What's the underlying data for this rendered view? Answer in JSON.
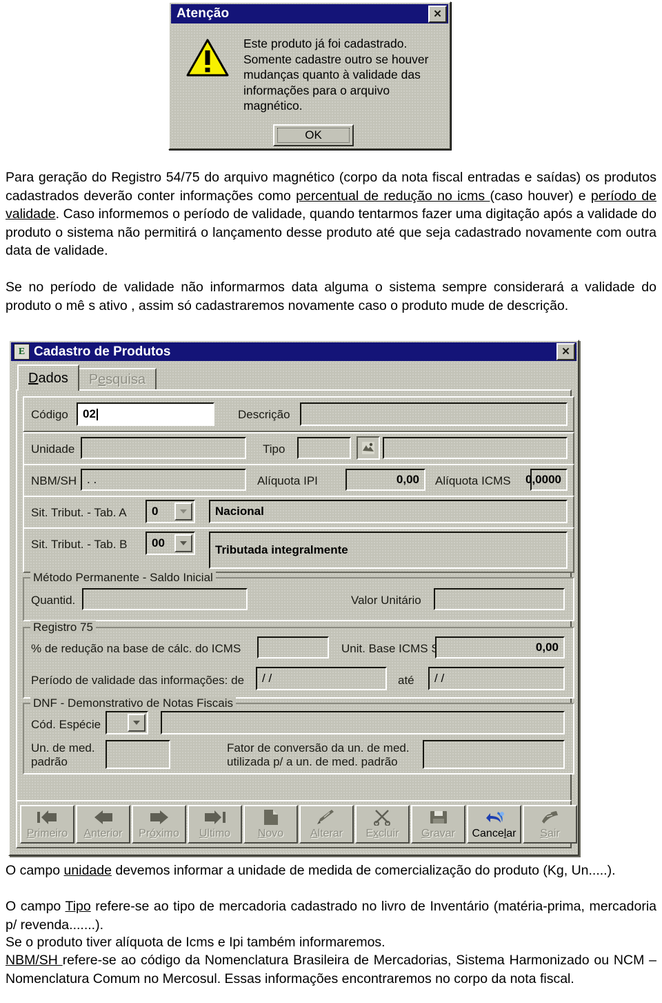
{
  "alert": {
    "title": "Atenção",
    "close_label": "✕",
    "icon": "warning-triangle-icon",
    "message_lines": [
      "Este produto já foi cadastrado.",
      "Somente cadastre outro se houver",
      "mudanças quanto à validade das",
      "informações para o arquivo magnético."
    ],
    "ok_label": "OK"
  },
  "paragraph_top": {
    "html": "Para geração do Registro 54/75 do arquivo magnético (corpo da nota fiscal entradas e saídas) os produtos cadastrados deverão conter informações como <u>percentual de redução no icms </u>(caso houver) e <u> período de validade</u>. Caso informemos o período de validade, quando  tentarmos fazer uma digitação após a validade do produto o sistema não permitirá o lançamento desse produto até que seja cadastrado novamente com outra data de validade."
  },
  "paragraph_top2": {
    "html": "Se no período de validade não informarmos data alguma o sistema sempre considerará a validade do produto o mê s ativo , assim só cadastraremos novamente caso o produto mude de descrição."
  },
  "form": {
    "title": "Cadastro de Produtos",
    "icon": "application-icon",
    "close_label": "✕",
    "tabs": [
      {
        "label": "Dados",
        "accel": "D",
        "active": true
      },
      {
        "label": "Pesquisa",
        "accel": "e",
        "active": false
      }
    ],
    "row_codigo": {
      "codigo_label": "Código",
      "codigo_value": "02",
      "descricao_label": "Descrição",
      "descricao_value": ""
    },
    "row_unidade": {
      "unidade_label": "Unidade",
      "unidade_value": "",
      "tipo_label": "Tipo",
      "tipo_value": "",
      "tipo_icon": "picture-lookup-icon",
      "tipo_desc_value": ""
    },
    "row_nbm": {
      "nbm_label": "NBM/SH",
      "nbm_value": ". .",
      "ipi_label": "Alíquota IPI",
      "ipi_value": "0,00",
      "icms_label": "Alíquota ICMS",
      "icms_value": "0,0000"
    },
    "row_tab_a": {
      "label": "Sit. Tribut. - Tab. A",
      "code": "0",
      "description": "Nacional"
    },
    "row_tab_b": {
      "label": "Sit. Tribut. - Tab. B",
      "code": "00",
      "description": "Tributada integralmente"
    },
    "group_metodo": {
      "title": "Método Permanente - Saldo Inicial",
      "quantid_label": "Quantid.",
      "quantid_value": "",
      "valor_label": "Valor Unitário",
      "valor_value": ""
    },
    "group_registro75": {
      "title": "Registro 75",
      "reducao_label": "% de redução na base de cálc. do ICMS",
      "reducao_value": "",
      "unit_base_label": "Unit. Base ICMS ST",
      "unit_base_value": "0,00",
      "periodo_label": "Período de validade das informações: de",
      "periodo_de_value": "/ /",
      "ate_label": "até",
      "periodo_ate_value": "/ /"
    },
    "group_dnf": {
      "title": "DNF - Demonstrativo de Notas Fiscais",
      "especie_label": "Cód. Espécie",
      "especie_code": "",
      "especie_desc": "",
      "un_med_label_l1": "Un. de med.",
      "un_med_label_l2": "padrão",
      "un_med_value": "",
      "fator_label_l1": "Fator de conversão da un. de med.",
      "fator_label_l2": "utilizada p/ a un. de med. padrão",
      "fator_value": ""
    },
    "toolbar": {
      "buttons": [
        {
          "label": "Primeiro",
          "accel": "P",
          "icon": "first-record-icon",
          "glyph": "|⬅",
          "enabled": false
        },
        {
          "label": "Anterior",
          "accel": "A",
          "icon": "previous-record-icon",
          "glyph": "⬅",
          "enabled": false
        },
        {
          "label": "Próximo",
          "accel": "ó",
          "icon": "next-record-icon",
          "glyph": "➡",
          "enabled": false
        },
        {
          "label": "Ultimo",
          "accel": "U",
          "icon": "last-record-icon",
          "glyph": "➡|",
          "enabled": false
        },
        {
          "label": "Novo",
          "accel": "N",
          "icon": "new-document-icon",
          "glyph": "",
          "enabled": false
        },
        {
          "label": "Alterar",
          "accel": "A",
          "icon": "edit-pencil-icon",
          "glyph": "",
          "enabled": false
        },
        {
          "label": "Excluir",
          "accel": "x",
          "icon": "delete-scissors-icon",
          "glyph": "✂",
          "enabled": false
        },
        {
          "label": "Gravar",
          "accel": "G",
          "icon": "save-floppy-icon",
          "glyph": "",
          "enabled": false
        },
        {
          "label": "Cancelar",
          "accel": "l",
          "icon": "undo-arrow-icon",
          "glyph": "",
          "enabled": true
        },
        {
          "label": "Sair",
          "accel": "S",
          "icon": "exit-door-icon",
          "glyph": "",
          "enabled": false
        }
      ]
    }
  },
  "paragraph_bottom1": {
    "html": "O campo <u>unidade</u> devemos informar a unidade de medida de comercialização do produto (Kg, Un.....)."
  },
  "paragraph_bottom2": {
    "html": "O campo <u>Tipo</u> refere-se ao tipo de mercadoria cadastrado no livro de Inventário (matéria-prima, mercadoria p/ revenda.......)."
  },
  "paragraph_bottom3": {
    "html": "Se o produto tiver alíquota de Icms e Ipi também informaremos."
  },
  "paragraph_bottom4": {
    "html": "<u>NBM/SH </u>refere-se ao código da Nomenclatura Brasileira de Mercadorias, Sistema Harmonizado ou NCM – Nomenclatura Comum no Mercosul. Essas informações encontraremos no corpo da nota fiscal."
  },
  "colors": {
    "titlebar": "#141478",
    "face": "#c3c3b8",
    "warning_yellow": "#f7f000",
    "cancel_icon_blue": "#1e3fb0"
  }
}
